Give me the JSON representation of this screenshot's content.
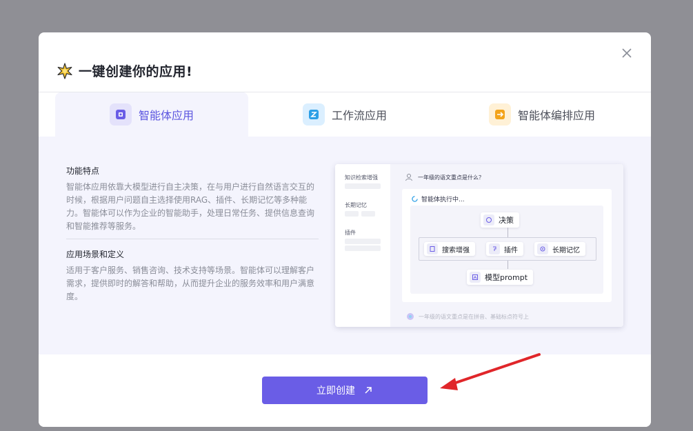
{
  "modal": {
    "title": "一键创建你的应用!",
    "close_icon": "close-icon",
    "star_icon": "sparkle-star-icon"
  },
  "tabs": [
    {
      "label": "智能体应用",
      "icon": "agent-icon",
      "icon_color": "#6a5de6",
      "icon_bg": "#e4e2fb"
    },
    {
      "label": "工作流应用",
      "icon": "workflow-icon",
      "icon_color": "#2c9fe6",
      "icon_bg": "#dbefff"
    },
    {
      "label": "智能体编排应用",
      "icon": "orchestration-icon",
      "icon_color": "#f3a41b",
      "icon_bg": "#fff1d6"
    }
  ],
  "features": {
    "title": "功能特点",
    "body": "智能体应用依靠大模型进行自主决策，在与用户进行自然语言交互的时候，根据用户问题自主选择使用RAG、插件、长期记忆等多种能力。智能体可以作为企业的智能助手，处理日常任务、提供信息查询和智能推荐等服务。"
  },
  "scenarios": {
    "title": "应用场景和定义",
    "body": "适用于客户服务、销售咨询、技术支持等场景。智能体可以理解客户需求，提供即时的解答和帮助，从而提升企业的服务效率和用户满意度。"
  },
  "preview": {
    "side_labels": [
      "知识检索增强",
      "长期记忆",
      "插件"
    ],
    "question": "一年级的语文重点是什么？",
    "executing": "智能体执行中...",
    "node_decision": "决策",
    "node_search": "搜索增强",
    "node_plugin": "插件",
    "node_memory": "长期记忆",
    "node_prompt": "模型prompt",
    "answer": "一年级的语文重点是在拼音、基础标点符号上"
  },
  "footer": {
    "create_label": "立即创建",
    "create_icon": "arrow-up-right-icon",
    "accent": "#6a5de6"
  },
  "annotation": {
    "arrow_color": "#e0262a"
  }
}
